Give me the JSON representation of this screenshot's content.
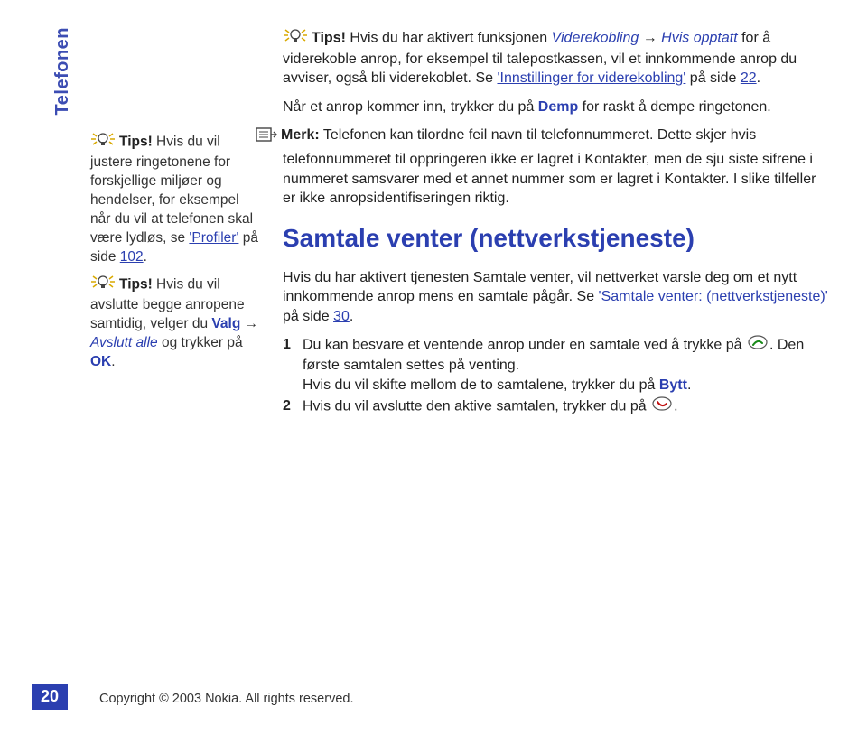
{
  "section_tab": "Telefonen",
  "sidebar": {
    "tip1_label": "Tips!",
    "tip1_text_a": " Hvis du vil justere ringetonene for forskjellige miljøer og hendelser, for eksempel når du vil at telefonen skal være lydløs, se ",
    "tip1_link": "'Profiler'",
    "tip1_text_b": " på side ",
    "tip1_page": "102",
    "tip1_text_c": ".",
    "tip2_label": "Tips!",
    "tip2_text_a": " Hvis du vil avslutte begge anropene samtidig, velger du ",
    "tip2_valg": "Valg",
    "tip2_arrow": " → ",
    "tip2_avslutt": "Avslutt alle",
    "tip2_text_b": " og trykker på ",
    "tip2_ok": "OK",
    "tip2_text_c": "."
  },
  "main": {
    "tip_label": "Tips!",
    "tip_text_a": " Hvis du har aktivert funksjonen ",
    "tip_fn1": "Viderekobling",
    "tip_arrow": " → ",
    "tip_fn2": "Hvis opptatt",
    "tip_text_b": " for å viderekoble anrop, for eksempel til talepostkassen, vil et innkommende anrop du avviser, også bli viderekoblet. Se ",
    "tip_link": "'Innstillinger for viderekobling'",
    "tip_text_c": " på side ",
    "tip_page": "22",
    "tip_text_d": ".",
    "para2_a": "Når et anrop kommer inn, trykker du på ",
    "para2_demp": "Demp",
    "para2_b": " for raskt å dempe ringetonen.",
    "note_label": "Merk:",
    "note_text": " Telefonen kan tilordne feil navn til telefonnummeret. Dette skjer hvis telefonnummeret til oppringeren ikke er lagret i Kontakter, men de sju siste sifrene i nummeret samsvarer med et annet nummer som er lagret i Kontakter. I slike tilfeller er ikke anropsidentifiseringen riktig.",
    "heading": "Samtale venter (nettverkstjeneste)",
    "para4_a": "Hvis du har aktivert tjenesten Samtale venter, vil nettverket varsle deg om et nytt innkommende anrop mens en samtale pågår. Se ",
    "para4_link": "'Samtale venter: (nettverkstjeneste)'",
    "para4_b": " på side ",
    "para4_page": "30",
    "para4_c": ".",
    "li1_num": "1",
    "li1_a": "Du kan besvare et ventende anrop under en samtale ved å trykke på ",
    "li1_b": ". Den første samtalen settes på venting.",
    "li1_c": "Hvis du vil skifte mellom de to samtalene, trykker du på ",
    "li1_bytt": "Bytt",
    "li1_d": ".",
    "li2_num": "2",
    "li2_a": "Hvis du vil avslutte den aktive samtalen, trykker du på ",
    "li2_b": "."
  },
  "footer": {
    "copyright": "Copyright © 2003 Nokia. All rights reserved.",
    "page_number": "20"
  }
}
